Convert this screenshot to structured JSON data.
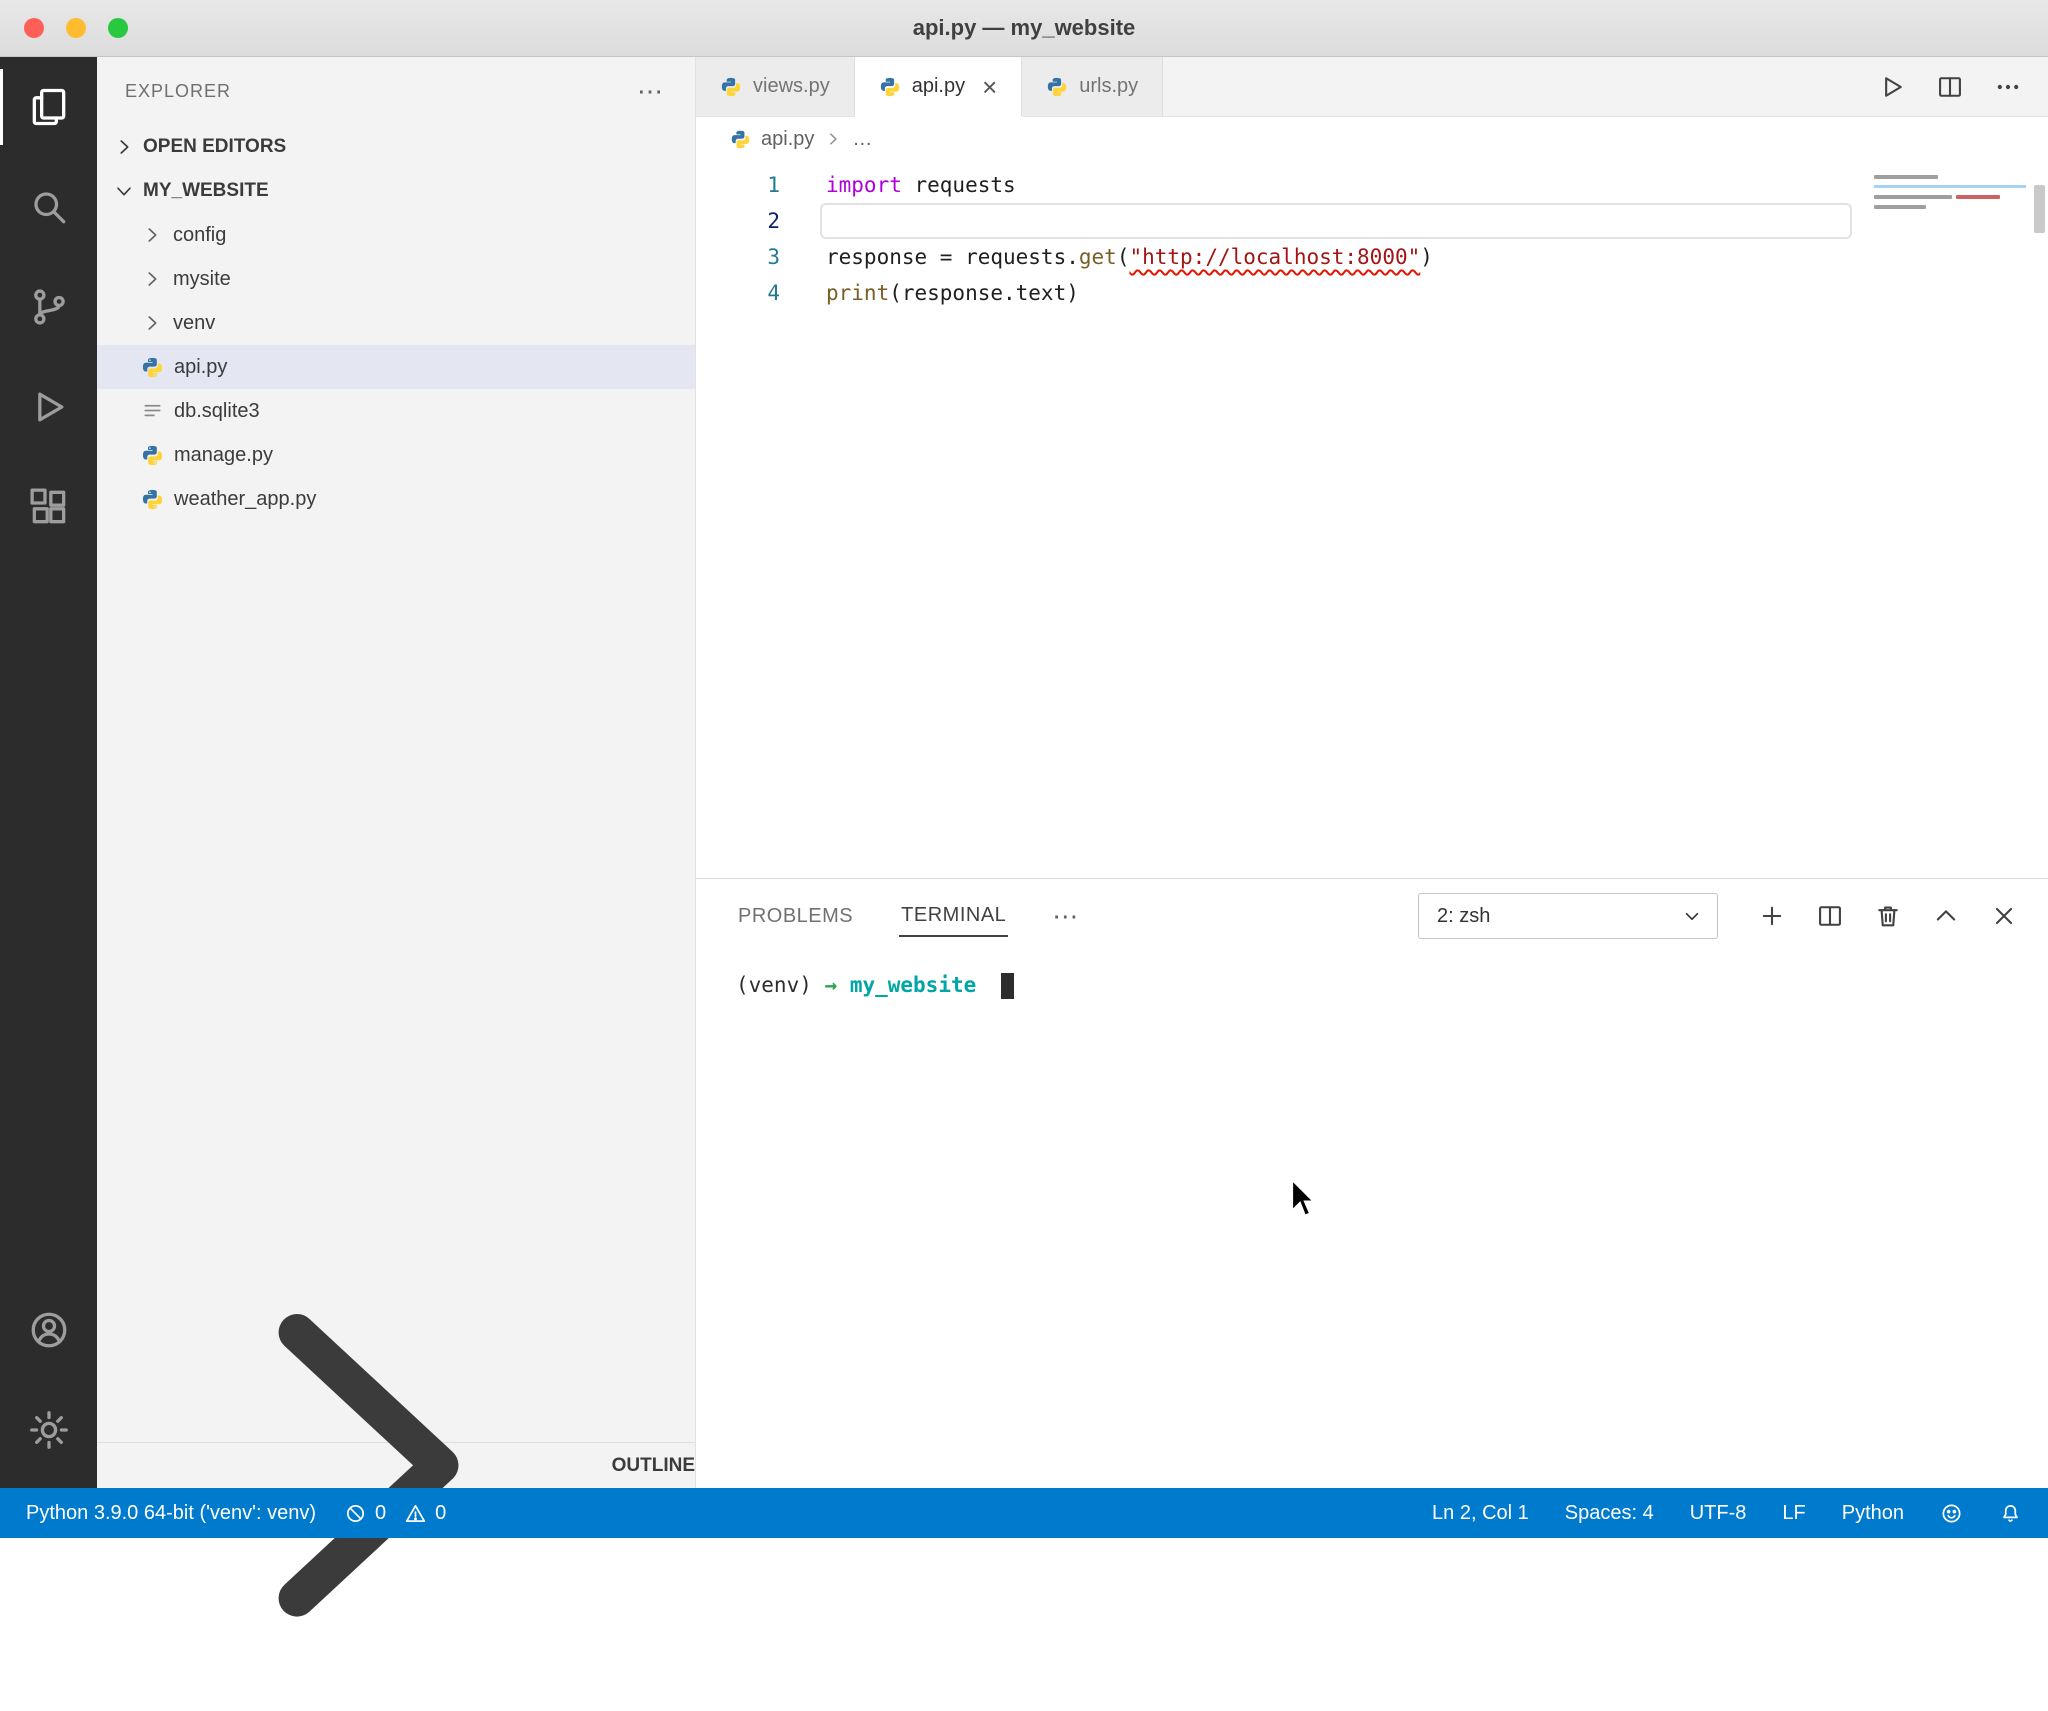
{
  "window": {
    "title": "api.py — my_website"
  },
  "activity_bar": {
    "items": [
      "explorer",
      "search",
      "source-control",
      "run-debug",
      "extensions"
    ],
    "bottom_items": [
      "account",
      "settings"
    ]
  },
  "sidebar": {
    "header": {
      "title": "EXPLORER",
      "more": "⋯"
    },
    "open_editors_label": "OPEN EDITORS",
    "root_label": "MY_WEBSITE",
    "tree": [
      {
        "label": "config",
        "type": "folder"
      },
      {
        "label": "mysite",
        "type": "folder"
      },
      {
        "label": "venv",
        "type": "folder"
      },
      {
        "label": "api.py",
        "type": "python-file",
        "selected": true
      },
      {
        "label": "db.sqlite3",
        "type": "file"
      },
      {
        "label": "manage.py",
        "type": "python-file"
      },
      {
        "label": "weather_app.py",
        "type": "python-file"
      }
    ],
    "outline_label": "OUTLINE"
  },
  "editor": {
    "tabs": [
      {
        "label": "views.py"
      },
      {
        "label": "api.py",
        "active": true,
        "close": "×"
      },
      {
        "label": "urls.py"
      }
    ],
    "breadcrumb": {
      "file": "api.py",
      "more": "…"
    },
    "lines": [
      {
        "num": "1",
        "k": "import",
        "rest": " requests"
      },
      {
        "num": "2"
      },
      {
        "num": "3",
        "pre": "response = requests.",
        "fn": "get",
        "open": "(",
        "str": "\"http://localhost:8000\"",
        "close": ")"
      },
      {
        "num": "4",
        "fn": "print",
        "rest": "(response.text)"
      }
    ]
  },
  "panel": {
    "tabs": {
      "problems": "PROBLEMS",
      "terminal": "TERMINAL",
      "more": "⋯"
    },
    "shell_selector": "2: zsh",
    "terminal_line": {
      "venv": "(venv)",
      "arrow": "→",
      "dir": "my_website"
    }
  },
  "status_bar": {
    "python_version": "Python 3.9.0 64-bit ('venv': venv)",
    "errors": "0",
    "warnings": "0",
    "cursor_position": "Ln 2, Col 1",
    "indentation": "Spaces: 4",
    "encoding": "UTF-8",
    "eol": "LF",
    "language": "Python"
  },
  "colors": {
    "accent": "#007acc",
    "activity_bar_bg": "#2c2c2c",
    "sidebar_bg": "#f3f3f3",
    "selection_bg": "#e4e6f1",
    "keyword": "#af00db",
    "string": "#a31515",
    "function": "#795e26",
    "line_number": "#237893"
  }
}
